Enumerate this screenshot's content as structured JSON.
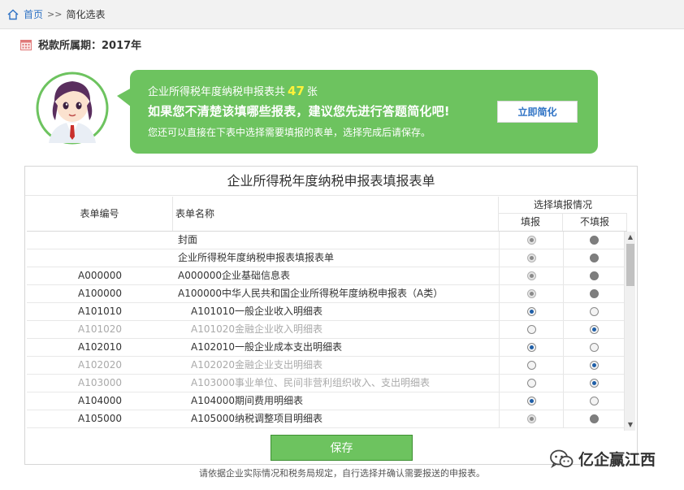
{
  "breadcrumb": {
    "home_label": "首页",
    "separator": ">>",
    "current": "简化选表"
  },
  "period": {
    "label": "税款所属期：2017年"
  },
  "bubble": {
    "line1_prefix": "企业所得税年度纳税申报表共",
    "count": "47",
    "line1_suffix": "张",
    "line2": "如果您不清楚该填哪些报表，建议您先进行答题简化吧!",
    "line3": "您还可以直接在下表中选择需要填报的表单，选择完成后请保存。",
    "simplify_button": "立即简化"
  },
  "table": {
    "title": "企业所得税年度纳税申报表填报表单",
    "headers": {
      "code": "表单编号",
      "name": "表单名称",
      "choice": "选择填报情况",
      "fill": "填报",
      "no_fill": "不填报"
    },
    "rows": [
      {
        "code": "",
        "name": "封面",
        "indent": false,
        "dim": false,
        "fill": "locked-on",
        "no_fill": "locked-off"
      },
      {
        "code": "",
        "name": "企业所得税年度纳税申报表填报表单",
        "indent": false,
        "dim": false,
        "fill": "locked-on",
        "no_fill": "locked-off"
      },
      {
        "code": "A000000",
        "name": "A000000企业基础信息表",
        "indent": false,
        "dim": false,
        "fill": "locked-on",
        "no_fill": "locked-off"
      },
      {
        "code": "A100000",
        "name": "A100000中华人民共和国企业所得税年度纳税申报表（A类）",
        "indent": false,
        "dim": false,
        "fill": "locked-on",
        "no_fill": "locked-off"
      },
      {
        "code": "A101010",
        "name": "A101010一般企业收入明细表",
        "indent": true,
        "dim": false,
        "fill": "on",
        "no_fill": "off"
      },
      {
        "code": "A101020",
        "name": "A101020金融企业收入明细表",
        "indent": true,
        "dim": true,
        "fill": "off",
        "no_fill": "on"
      },
      {
        "code": "A102010",
        "name": "A102010一般企业成本支出明细表",
        "indent": true,
        "dim": false,
        "fill": "on",
        "no_fill": "off"
      },
      {
        "code": "A102020",
        "name": "A102020金融企业支出明细表",
        "indent": true,
        "dim": true,
        "fill": "off",
        "no_fill": "on"
      },
      {
        "code": "A103000",
        "name": "A103000事业单位、民间非营利组织收入、支出明细表",
        "indent": true,
        "dim": true,
        "fill": "off",
        "no_fill": "on"
      },
      {
        "code": "A104000",
        "name": "A104000期间费用明细表",
        "indent": true,
        "dim": false,
        "fill": "on",
        "no_fill": "off"
      },
      {
        "code": "A105000",
        "name": "A105000纳税调整项目明细表",
        "indent": true,
        "dim": false,
        "fill": "locked-on",
        "no_fill": "locked-off"
      }
    ],
    "save_button": "保存"
  },
  "footnote": "请依据企业实际情况和税务局规定，自行选择并确认需要报送的申报表。",
  "watermark": {
    "text": "亿企赢江西",
    "icon": "wechat-icon"
  },
  "colors": {
    "accent_green": "#6dc35f",
    "link_blue": "#2f73c5",
    "highlight_yellow": "#fff23a"
  }
}
